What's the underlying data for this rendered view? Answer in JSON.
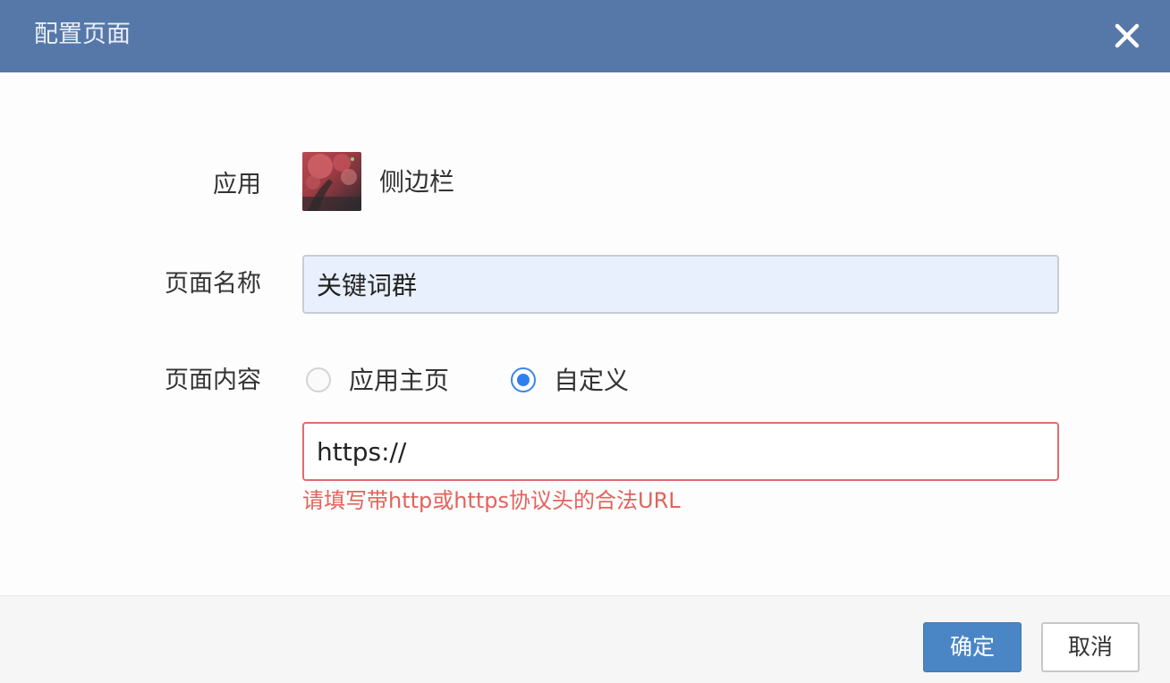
{
  "dialog": {
    "title": "配置页面",
    "close_icon": "close-icon"
  },
  "form": {
    "app": {
      "label": "应用",
      "icon": "app-thumbnail",
      "name": "侧边栏"
    },
    "page_name": {
      "label": "页面名称",
      "value": "关键词群"
    },
    "page_content": {
      "label": "页面内容",
      "options": [
        {
          "label": "应用主页",
          "selected": false
        },
        {
          "label": "自定义",
          "selected": true
        }
      ],
      "url_value": "https://",
      "error": "请填写带http或https协议头的合法URL"
    }
  },
  "footer": {
    "ok_label": "确定",
    "cancel_label": "取消"
  },
  "colors": {
    "header": "#5678a8",
    "primary": "#4a86c6",
    "error": "#e4625c",
    "radio_selected": "#2f80ed"
  }
}
